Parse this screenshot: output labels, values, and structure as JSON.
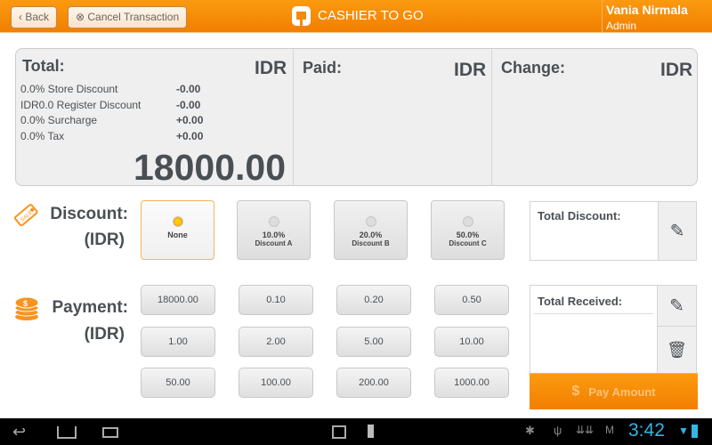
{
  "header": {
    "back_label": "Back",
    "cancel_label": "Cancel Transaction",
    "app_title": "CASHIER TO GO",
    "user_name": "Vania Nirmala",
    "user_role": "Admin"
  },
  "summary": {
    "total_label": "Total:",
    "paid_label": "Paid:",
    "change_label": "Change:",
    "currency": "IDR",
    "lines": [
      {
        "label": "0.0% Store Discount",
        "value": "-0.00"
      },
      {
        "label": "IDR0.0 Register Discount",
        "value": "-0.00"
      },
      {
        "label": "0.0% Surcharge",
        "value": "+0.00"
      },
      {
        "label": "0.0% Tax",
        "value": "+0.00"
      }
    ],
    "total_amount": "18000.00"
  },
  "discount": {
    "label": "Discount:",
    "unit": "(IDR)",
    "options": [
      {
        "value": "None",
        "name": "",
        "selected": true
      },
      {
        "value": "10.0%",
        "name": "Discount A",
        "selected": false
      },
      {
        "value": "20.0%",
        "name": "Discount B",
        "selected": false
      },
      {
        "value": "50.0%",
        "name": "Discount C",
        "selected": false
      }
    ],
    "total_label": "Total Discount:"
  },
  "payment": {
    "label": "Payment:",
    "unit": "(IDR)",
    "amounts": [
      "18000.00",
      "0.10",
      "0.20",
      "0.50",
      "1.00",
      "2.00",
      "5.00",
      "10.00",
      "50.00",
      "100.00",
      "200.00",
      "1000.00"
    ],
    "total_label": "Total Received:",
    "pay_label": "Pay Amount"
  },
  "status_bar": {
    "time": "3:42"
  },
  "colors": {
    "accent": "#f7941d",
    "clock": "#33b5e5"
  }
}
